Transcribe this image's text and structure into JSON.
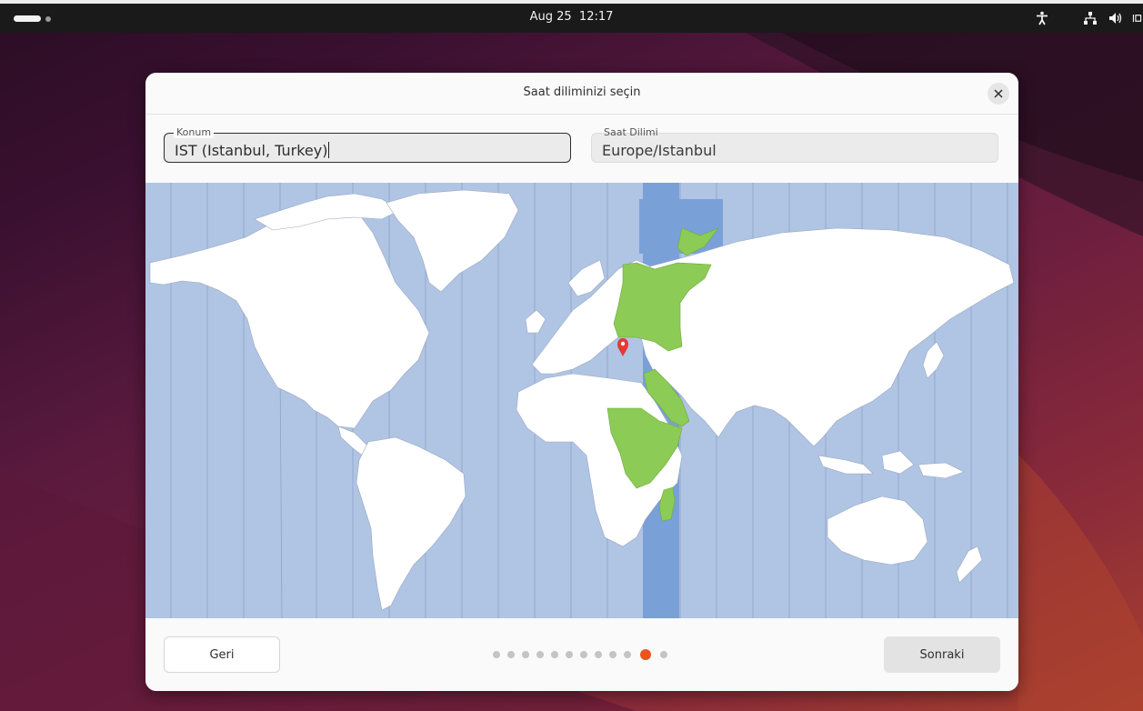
{
  "topbar": {
    "date": "Aug 25",
    "time": "12:17",
    "icons": [
      "accessibility-icon",
      "network-icon",
      "volume-icon",
      "power-icon"
    ]
  },
  "dialog": {
    "title": "Saat diliminizi seçin",
    "location_field": {
      "label": "Konum",
      "value": "IST (Istanbul, Turkey)"
    },
    "timezone_field": {
      "label": "Saat Dilimi",
      "value": "Europe/Istanbul"
    },
    "selected_city": "Istanbul",
    "back_label": "Geri",
    "next_label": "Sonraki",
    "progress": {
      "total_steps": 12,
      "current_step": 11
    }
  },
  "colors": {
    "accent": "#e95420",
    "ocean": "#b0c4e4",
    "selected_zone": "#7aa0d8",
    "selected_land": "#8ccb55",
    "land": "#ffffff"
  }
}
